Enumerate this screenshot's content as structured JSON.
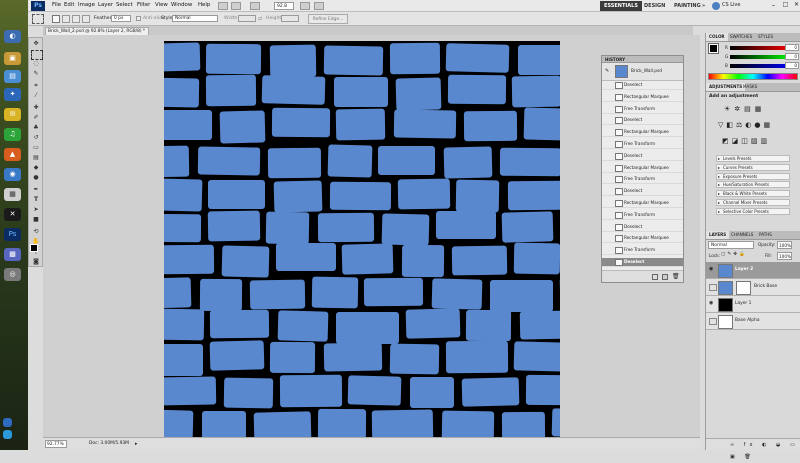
{
  "app": {
    "logo": "Ps",
    "zoom_label": "92.8",
    "workspaces": [
      "ESSENTIALS",
      "DESIGN",
      "PAINTING",
      "»"
    ],
    "cs_live": "CS Live"
  },
  "menu": [
    "File",
    "Edit",
    "Image",
    "Layer",
    "Select",
    "Filter",
    "View",
    "Window",
    "Help"
  ],
  "options_bar": {
    "feather_label": "Feather:",
    "feather_value": "0 px",
    "antialias_label": "Anti-alias",
    "style_label": "Style:",
    "style_value": "Normal",
    "width_label": "Width:",
    "height_label": "Height:",
    "refine_label": "Refine Edge..."
  },
  "document": {
    "tab_title": "Brick_Wall_2.psd @ 92.8% (Layer 2, RGB/8) *",
    "canvas_color": "#5a88cf",
    "grout_color": "#000000"
  },
  "status": {
    "zoom": "92.77%",
    "doc": "Doc: 3.00M/5.93M"
  },
  "history": {
    "title": "HISTORY",
    "snapshot": "Brick_Wall.psd",
    "items": [
      "Deselect",
      "Rectangular Marquee",
      "Free Transform",
      "Deselect",
      "Rectangular Marquee",
      "Free Transform",
      "Deselect",
      "Rectangular Marquee",
      "Free Transform",
      "Deselect",
      "Rectangular Marquee",
      "Free Transform",
      "Deselect",
      "Rectangular Marquee",
      "Free Transform",
      "Deselect"
    ],
    "active_index": 15
  },
  "color_panel": {
    "tabs": [
      "COLOR",
      "SWATCHES",
      "STYLES"
    ],
    "channels": [
      {
        "name": "R",
        "value": "0"
      },
      {
        "name": "G",
        "value": "0"
      },
      {
        "name": "B",
        "value": "0"
      }
    ]
  },
  "adjustments": {
    "tabs": [
      "ADJUSTMENTS",
      "MASKS"
    ],
    "heading": "Add an adjustment",
    "presets": [
      "Levels Presets",
      "Curves Presets",
      "Exposure Presets",
      "Hue/Saturation Presets",
      "Black & White Presets",
      "Channel Mixer Presets",
      "Selective Color Presets"
    ]
  },
  "layers": {
    "tabs": [
      "LAYERS",
      "CHANNELS",
      "PATHS"
    ],
    "blend_mode": "Normal",
    "opacity_label": "Opacity:",
    "opacity": "100%",
    "lock_label": "Lock:",
    "fill_label": "Fill:",
    "fill": "100%",
    "rows": [
      {
        "name": "Layer 2",
        "visible": true,
        "selected": true
      },
      {
        "name": "Brick Base",
        "visible": false,
        "selected": false
      },
      {
        "name": "Layer 1",
        "visible": true,
        "selected": false
      },
      {
        "name": "Base Alpha",
        "visible": false,
        "selected": false
      }
    ]
  }
}
